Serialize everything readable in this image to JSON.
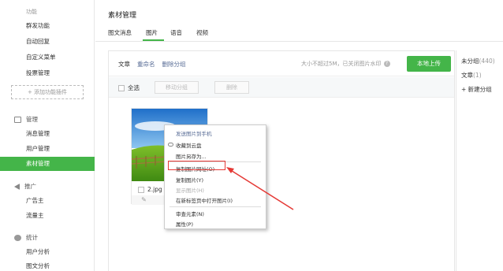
{
  "sidebar": {
    "func_label": "功能",
    "func_items": [
      "群发功能",
      "自动回复",
      "自定义菜单",
      "投票管理"
    ],
    "add_plugin": "+ 添加功能插件",
    "manage_label": "管理",
    "manage_items": [
      "消息管理",
      "用户管理",
      "素材管理"
    ],
    "promo_label": "推广",
    "promo_items": [
      "广告主",
      "流量主"
    ],
    "stats_label": "统计",
    "stats_items": [
      "用户分析",
      "图文分析"
    ]
  },
  "header": {
    "title": "素材管理",
    "tabs": [
      "图文消息",
      "图片",
      "语音",
      "视频"
    ],
    "active_tab": "图片"
  },
  "toolbar": {
    "crumb_label": "文章",
    "rename": "重命名",
    "delete_group": "删除分组",
    "size_tip": "大小不超过5M，已关闭图片水印",
    "upload": "本地上传"
  },
  "actions": {
    "select_all": "全选",
    "move_group": "移动分组",
    "delete": "删除"
  },
  "image_card": {
    "file_name": "2.jpg"
  },
  "context_menu": {
    "items": [
      "发送图片到手机",
      "收藏到云盘",
      "图片另存为...",
      "复制图片网址(O)",
      "复制图片(Y)",
      "显示图片(H)",
      "在新标签页中打开图片(I)",
      "审查元素(N)",
      "属性(P)"
    ],
    "highlighted_index": 3
  },
  "right_panel": {
    "groups": [
      {
        "name": "未分组",
        "count": "(440)"
      },
      {
        "name": "文章",
        "count": "(1)"
      }
    ],
    "new_group": "+ 新建分组"
  },
  "colors": {
    "accent": "#44b549",
    "link": "#576b95",
    "highlight": "#e53935"
  }
}
